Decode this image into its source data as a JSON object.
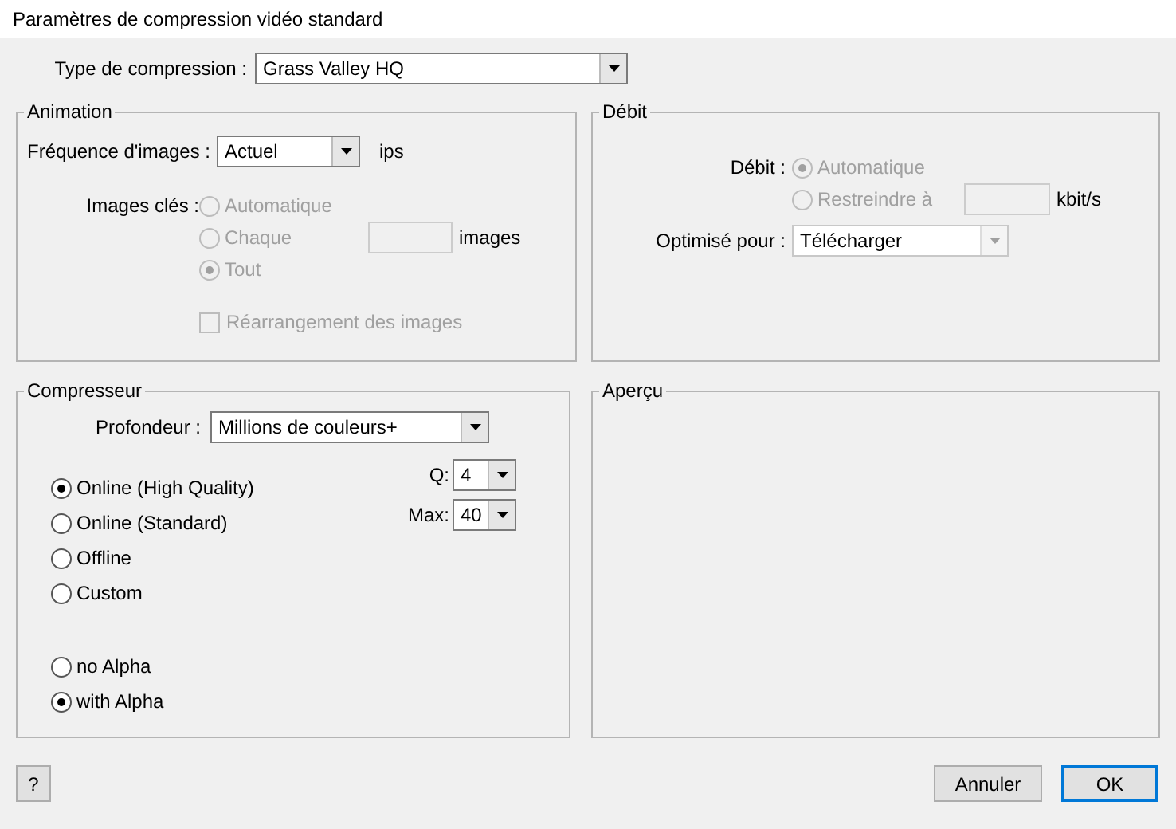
{
  "window": {
    "title": "Paramètres de compression vidéo standard"
  },
  "compression_type": {
    "label": "Type de compression :",
    "value": "Grass Valley HQ"
  },
  "animation": {
    "title": "Animation",
    "frame_rate": {
      "label": "Fréquence d'images :",
      "value": "Actuel",
      "unit": "ips"
    },
    "keyframes": {
      "label": "Images clés :",
      "disabled": true,
      "unit": "images",
      "options": [
        {
          "label": "Automatique",
          "selected": false
        },
        {
          "label": "Chaque",
          "selected": false
        },
        {
          "label": "Tout",
          "selected": true
        }
      ]
    },
    "reorder": {
      "label": "Réarrangement des images",
      "checked": false,
      "disabled": true
    }
  },
  "bitrate": {
    "title": "Débit",
    "label": "Débit :",
    "disabled": true,
    "unit": "kbit/s",
    "options": [
      {
        "label": "Automatique",
        "selected": true
      },
      {
        "label": "Restreindre à",
        "selected": false
      }
    ],
    "optimized_for": {
      "label": "Optimisé pour :",
      "value": "Télécharger",
      "disabled": true
    }
  },
  "compressor": {
    "title": "Compresseur",
    "depth": {
      "label": "Profondeur :",
      "value": "Millions de couleurs+"
    },
    "quality_options": [
      {
        "label": "Online (High Quality)",
        "selected": true
      },
      {
        "label": "Online (Standard)",
        "selected": false
      },
      {
        "label": "Offline",
        "selected": false
      },
      {
        "label": "Custom",
        "selected": false
      }
    ],
    "alpha_options": [
      {
        "label": "no Alpha",
        "selected": false
      },
      {
        "label": "with Alpha",
        "selected": true
      }
    ],
    "q": {
      "label": "Q:",
      "value": "4"
    },
    "max": {
      "label": "Max:",
      "value": "40"
    }
  },
  "preview": {
    "title": "Aperçu"
  },
  "buttons": [
    {
      "label": "?",
      "default": false
    },
    {
      "label": "Annuler",
      "default": false
    },
    {
      "label": "OK",
      "default": true
    }
  ]
}
